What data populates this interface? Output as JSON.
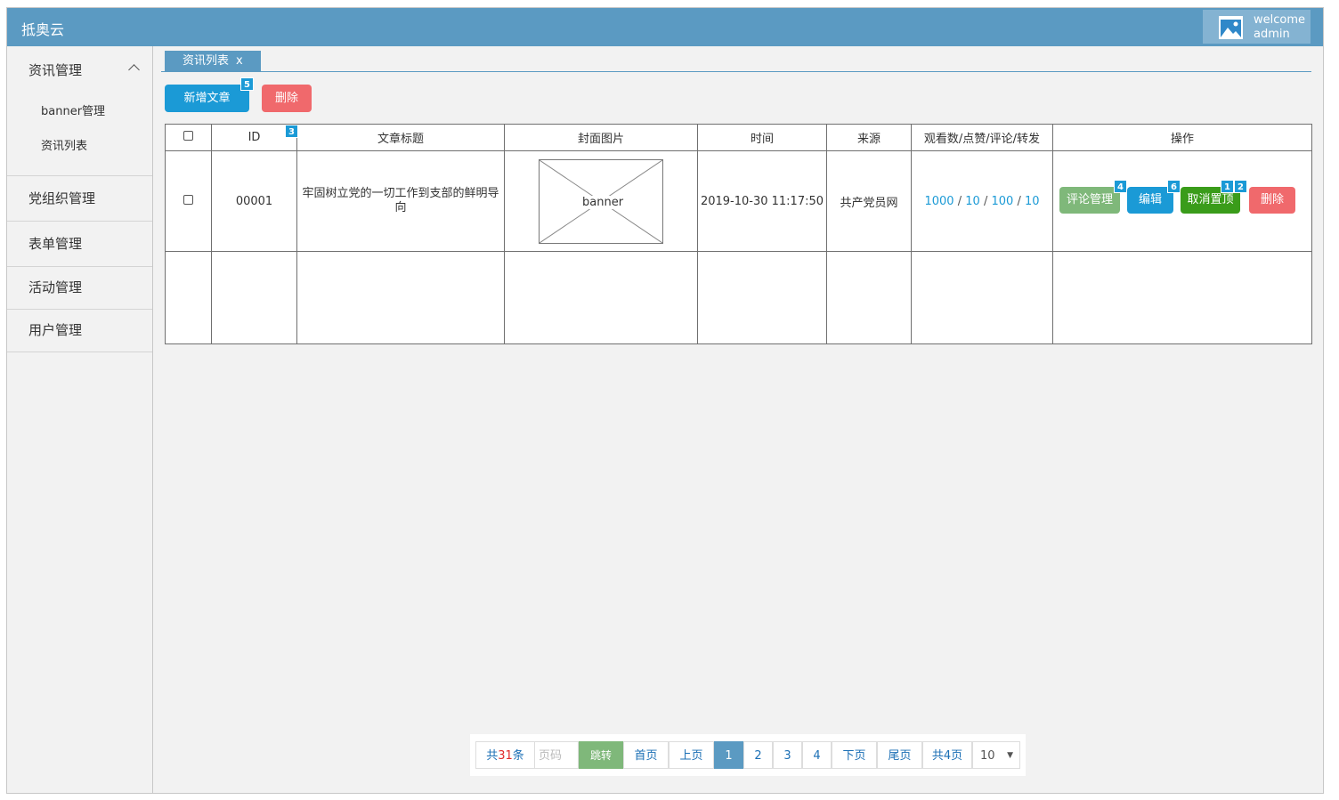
{
  "app": {
    "title": "抵奥云"
  },
  "user": {
    "greeting": "welcome",
    "name": "admin"
  },
  "sidebar": {
    "groups": [
      {
        "label": "资讯管理",
        "expanded": true,
        "items": [
          {
            "label": "banner管理"
          },
          {
            "label": "资讯列表"
          }
        ]
      },
      {
        "label": "党组织管理"
      },
      {
        "label": "表单管理"
      },
      {
        "label": "活动管理"
      },
      {
        "label": "用户管理"
      }
    ]
  },
  "tabs": [
    {
      "label": "资讯列表",
      "close": "x"
    }
  ],
  "toolbar": {
    "add_label": "新增文章",
    "delete_label": "删除"
  },
  "badges": {
    "add": "5",
    "id_header": "3",
    "comment": "4",
    "edit": "6",
    "untop_a": "1",
    "untop_b": "2"
  },
  "table": {
    "headers": [
      "ID",
      "文章标题",
      "封面图片",
      "时间",
      "来源",
      "观看数/点赞/评论/转发",
      "操作"
    ],
    "rows": [
      {
        "id": "00001",
        "title": "牢固树立党的一切工作到支部的鲜明导向",
        "cover": "banner",
        "time": "2019-10-30 11:17:50",
        "source": "共产党员网",
        "stats": {
          "views": "1000",
          "likes": "10",
          "comments": "100",
          "shares": "10",
          "sep": "/"
        },
        "actions": {
          "comment": "评论管理",
          "edit": "编辑",
          "untop": "取消置顶",
          "delete": "删除"
        }
      }
    ]
  },
  "pager": {
    "total_prefix": "共",
    "total_count": "31",
    "total_suffix": "条",
    "page_input_placeholder": "页码",
    "jump": "跳转",
    "first": "首页",
    "prev": "上页",
    "pages": [
      "1",
      "2",
      "3",
      "4"
    ],
    "current": "1",
    "next": "下页",
    "last": "尾页",
    "total_pages": "共4页",
    "page_size": "10"
  },
  "colors": {
    "primary": "#5b9ac2",
    "blue": "#1b9ad6",
    "red": "#f0696c",
    "green": "#3a9c1a",
    "light_green": "#7fb87a"
  }
}
